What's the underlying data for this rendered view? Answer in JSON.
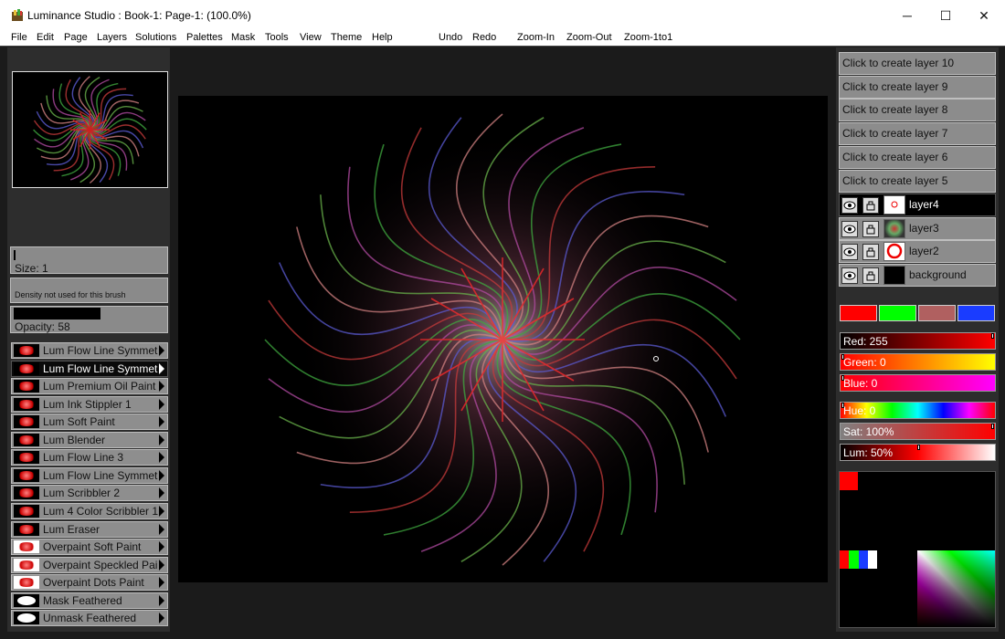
{
  "window": {
    "title": "Luminance Studio : Book-1: Page-1:  (100.0%)",
    "minimize_glyph": "─",
    "maximize_glyph": "☐",
    "close_glyph": "✕"
  },
  "menu": [
    "File",
    "Edit",
    "Page",
    "Layers",
    "Solutions",
    "Palettes",
    "Mask",
    "Tools",
    "View",
    "Theme",
    "Help"
  ],
  "toolbar": [
    "Undo",
    "Redo",
    "Zoom-In",
    "Zoom-Out",
    "Zoom-1to1"
  ],
  "brush_settings": {
    "size_label": "Size: 1",
    "density_label": "Density not used for this brush",
    "opacity_label": "Opacity: 58",
    "opacity_value": 0.58
  },
  "brushes": [
    {
      "label": "Lum Flow Line Symmetr",
      "icon": "flow-symmetry-icon"
    },
    {
      "label": "Lum Flow Line Symmetr",
      "icon": "flow-symmetry-icon",
      "selected": true
    },
    {
      "label": "Lum Premium Oil Paint",
      "icon": "oil-paint-icon"
    },
    {
      "label": "Lum Ink Stippler 1",
      "icon": "stippler-icon"
    },
    {
      "label": "Lum Soft Paint",
      "icon": "soft-paint-icon"
    },
    {
      "label": "Lum Blender",
      "icon": "blender-icon"
    },
    {
      "label": "Lum Flow Line 3",
      "icon": "flow-line-icon"
    },
    {
      "label": "Lum Flow Line Symmetr",
      "icon": "flow-symmetry-icon"
    },
    {
      "label": "Lum Scribbler 2",
      "icon": "scribbler-icon"
    },
    {
      "label": "Lum 4 Color Scribbler 1",
      "icon": "color-scribbler-icon"
    },
    {
      "label": "Lum Eraser",
      "icon": "eraser-icon"
    },
    {
      "label": "Overpaint Soft Paint",
      "icon": "overpaint-soft-icon"
    },
    {
      "label": "Overpaint Speckled Pain",
      "icon": "overpaint-speckled-icon"
    },
    {
      "label": "Overpaint Dots Paint",
      "icon": "overpaint-dots-icon"
    },
    {
      "label": "Mask Feathered",
      "icon": "mask-feathered-icon"
    },
    {
      "label": "Unmask Feathered",
      "icon": "unmask-feathered-icon"
    }
  ],
  "layers": {
    "create": [
      "Click to create layer 10",
      "Click to create layer 9",
      "Click to create layer 8",
      "Click to create layer 7",
      "Click to create layer 6",
      "Click to create layer 5"
    ],
    "items": [
      {
        "name": "layer4",
        "selected": true
      },
      {
        "name": "layer3"
      },
      {
        "name": "layer2"
      },
      {
        "name": "background"
      }
    ]
  },
  "colors": {
    "swatches": [
      "#ff0000",
      "#00ff00",
      "#b06060",
      "#1a3cff"
    ],
    "red_label": "Red: 255",
    "green_label": "Green: 0",
    "blue_label": "Blue: 0",
    "hue_label": "Hue: 0",
    "sat_label": "Sat: 100%",
    "lum_label": "Lum: 50%",
    "red": 255,
    "green": 0,
    "blue": 0,
    "hue": 0,
    "saturation": 100,
    "luminance": 50
  }
}
